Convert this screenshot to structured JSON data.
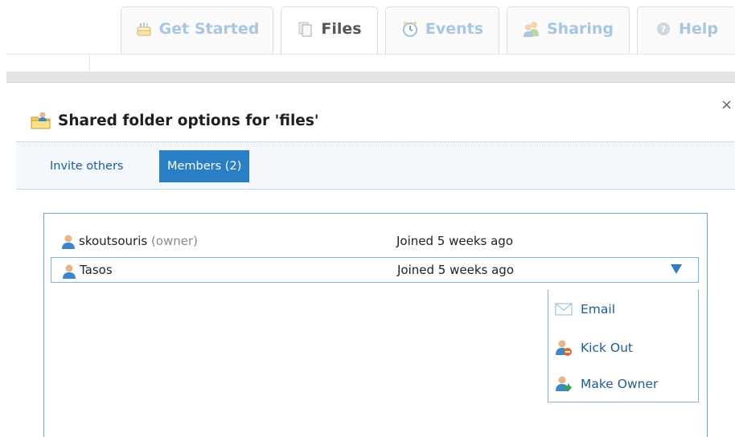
{
  "top_tabs": [
    {
      "label": "Get Started",
      "icon": "cake-icon",
      "active": false
    },
    {
      "label": "Files",
      "icon": "files-icon",
      "active": true
    },
    {
      "label": "Events",
      "icon": "clock-icon",
      "active": false
    },
    {
      "label": "Sharing",
      "icon": "people-icon",
      "active": false
    },
    {
      "label": "Help",
      "icon": "help-icon",
      "active": false
    }
  ],
  "dialog": {
    "title": "Shared folder options for 'files'",
    "title_icon": "shared-folder-icon",
    "close_label": "×",
    "tabs": [
      {
        "label": "Invite others",
        "active": false
      },
      {
        "label": "Members (2)",
        "active": true
      }
    ]
  },
  "members": [
    {
      "name": "skoutsouris",
      "role": "(owner)",
      "joined": "Joined 5 weeks ago",
      "selected": false
    },
    {
      "name": "Tasos",
      "role": "",
      "joined": "Joined 5 weeks ago",
      "selected": true
    }
  ],
  "member_menu": [
    {
      "label": "Email",
      "icon": "envelope-icon"
    },
    {
      "label": "Kick Out",
      "icon": "user-remove-icon"
    },
    {
      "label": "Make Owner",
      "icon": "user-promote-icon"
    }
  ],
  "colors": {
    "accent": "#2a7fc4",
    "link": "#1d5c96",
    "tab_inactive_text": "#a8c6e0"
  }
}
